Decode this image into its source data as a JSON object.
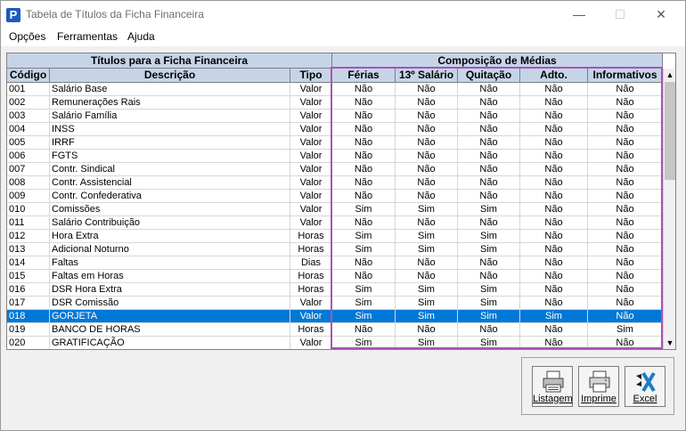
{
  "window": {
    "title": "Tabela de Títulos da Ficha Financeira",
    "logo_letter": "P",
    "min_glyph": "—",
    "max_glyph": "☐",
    "close_glyph": "✕"
  },
  "menu": [
    "Opções",
    "Ferramentas",
    "Ajuda"
  ],
  "grid": {
    "group_headers": {
      "left": "Títulos para a Ficha Financeira",
      "right": "Composição de Médias"
    },
    "columns": [
      "Código",
      "Descrição",
      "Tipo",
      "Férias",
      "13º Salário",
      "Quitação",
      "Adto.",
      "Informativos"
    ],
    "selected_index": 17,
    "rows": [
      [
        "001",
        "Salário Base",
        "Valor",
        "Não",
        "Não",
        "Não",
        "Não",
        "Não"
      ],
      [
        "002",
        "Remunerações Rais",
        "Valor",
        "Não",
        "Não",
        "Não",
        "Não",
        "Não"
      ],
      [
        "003",
        "Salário Família",
        "Valor",
        "Não",
        "Não",
        "Não",
        "Não",
        "Não"
      ],
      [
        "004",
        "INSS",
        "Valor",
        "Não",
        "Não",
        "Não",
        "Não",
        "Não"
      ],
      [
        "005",
        "IRRF",
        "Valor",
        "Não",
        "Não",
        "Não",
        "Não",
        "Não"
      ],
      [
        "006",
        "FGTS",
        "Valor",
        "Não",
        "Não",
        "Não",
        "Não",
        "Não"
      ],
      [
        "007",
        "Contr. Sindical",
        "Valor",
        "Não",
        "Não",
        "Não",
        "Não",
        "Não"
      ],
      [
        "008",
        "Contr. Assistencial",
        "Valor",
        "Não",
        "Não",
        "Não",
        "Não",
        "Não"
      ],
      [
        "009",
        "Contr. Confederativa",
        "Valor",
        "Não",
        "Não",
        "Não",
        "Não",
        "Não"
      ],
      [
        "010",
        "Comissões",
        "Valor",
        "Sim",
        "Sim",
        "Sim",
        "Não",
        "Não"
      ],
      [
        "011",
        "Salário Contribuição",
        "Valor",
        "Não",
        "Não",
        "Não",
        "Não",
        "Não"
      ],
      [
        "012",
        "Hora Extra",
        "Horas",
        "Sim",
        "Sim",
        "Sim",
        "Não",
        "Não"
      ],
      [
        "013",
        "Adicional Noturno",
        "Horas",
        "Sim",
        "Sim",
        "Sim",
        "Não",
        "Não"
      ],
      [
        "014",
        "Faltas",
        "Dias",
        "Não",
        "Não",
        "Não",
        "Não",
        "Não"
      ],
      [
        "015",
        "Faltas em Horas",
        "Horas",
        "Não",
        "Não",
        "Não",
        "Não",
        "Não"
      ],
      [
        "016",
        "DSR Hora Extra",
        "Horas",
        "Sim",
        "Sim",
        "Sim",
        "Não",
        "Não"
      ],
      [
        "017",
        "DSR Comissão",
        "Valor",
        "Sim",
        "Sim",
        "Sim",
        "Não",
        "Não"
      ],
      [
        "018",
        "GORJETA",
        "Valor",
        "Sim",
        "Sim",
        "Sim",
        "Sim",
        "Não"
      ],
      [
        "019",
        "BANCO DE HORAS",
        "Horas",
        "Não",
        "Não",
        "Não",
        "Não",
        "Sim"
      ],
      [
        "020",
        "GRATIFICAÇÃO",
        "Valor",
        "Sim",
        "Sim",
        "Sim",
        "Não",
        "Não"
      ]
    ]
  },
  "scrollbar": {
    "up_glyph": "▲",
    "down_glyph": "▼"
  },
  "buttons": {
    "listagem": "Listagem",
    "imprime": "Imprime",
    "excel": "Excel"
  },
  "colors": {
    "header_bg": "#c6d4e8",
    "selection": "#0078d7",
    "highlight_border": "#a855b5"
  }
}
